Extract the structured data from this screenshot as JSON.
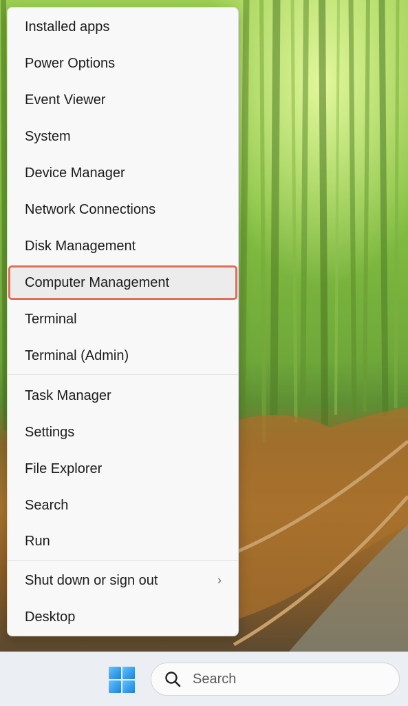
{
  "menu": {
    "items": [
      {
        "label": "Installed apps"
      },
      {
        "label": "Power Options"
      },
      {
        "label": "Event Viewer"
      },
      {
        "label": "System"
      },
      {
        "label": "Device Manager"
      },
      {
        "label": "Network Connections"
      },
      {
        "label": "Disk Management"
      },
      {
        "label": "Computer Management"
      },
      {
        "label": "Terminal"
      },
      {
        "label": "Terminal (Admin)"
      },
      {
        "label": "Task Manager"
      },
      {
        "label": "Settings"
      },
      {
        "label": "File Explorer"
      },
      {
        "label": "Search"
      },
      {
        "label": "Run"
      },
      {
        "label": "Shut down or sign out",
        "submenu_glyph": "›"
      },
      {
        "label": "Desktop"
      }
    ],
    "highlighted_item": "Computer Management",
    "highlight_color": "#e06c5a"
  },
  "taskbar": {
    "start_icon": "windows-logo-icon",
    "search_icon": "search-icon",
    "search_placeholder": "Search"
  }
}
